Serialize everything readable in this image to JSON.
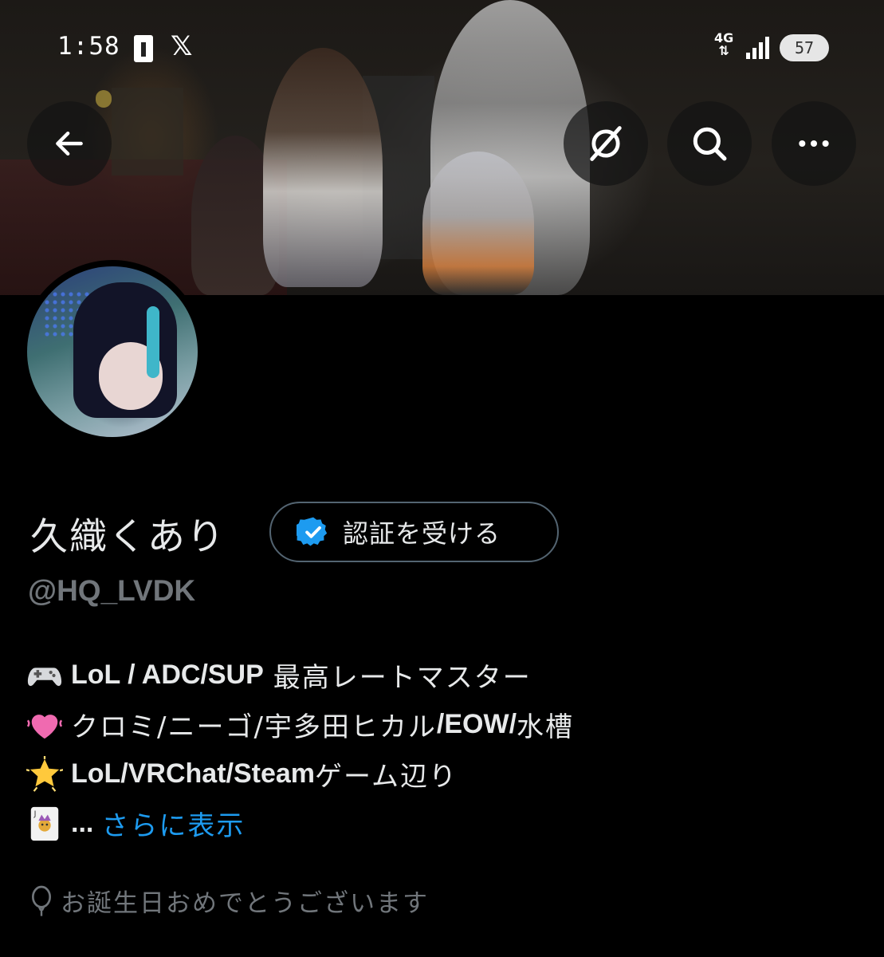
{
  "status_bar": {
    "time": "1:58",
    "network": "4G",
    "battery": "57"
  },
  "header": {
    "back_icon": "arrow-left-icon",
    "grok_icon": "grok-icon",
    "search_icon": "search-icon",
    "more_icon": "more-horizontal-icon"
  },
  "profile": {
    "display_name": "久織くあり",
    "verify_button_label": "認証を受ける",
    "handle": "@HQ_LVDK",
    "bio": [
      {
        "emoji": "video-game-emoji",
        "bold": "LoL / ADC/SUP ",
        "text": "最高レートマスター"
      },
      {
        "emoji": "pink-heart-emoji",
        "segments": [
          {
            "text": "クロミ/ニーゴ/宇多田ヒカル",
            "bold": false
          },
          {
            "text": "/EOW/",
            "bold": true
          },
          {
            "text": "水槽",
            "bold": false
          }
        ]
      },
      {
        "emoji": "glowing-star-emoji",
        "bold": "LoL/VRChat/Steam",
        "text": "ゲーム辺り"
      },
      {
        "emoji": "joker-card-emoji",
        "ellipsis": "...",
        "show_more": "さらに表示"
      }
    ],
    "birthday_text": "お誕生日おめでとうございます"
  },
  "colors": {
    "background": "#000000",
    "text_primary": "#e7e9ea",
    "text_secondary": "#71767b",
    "link": "#1d9bf0",
    "verified_blue": "#1d9bf0"
  }
}
